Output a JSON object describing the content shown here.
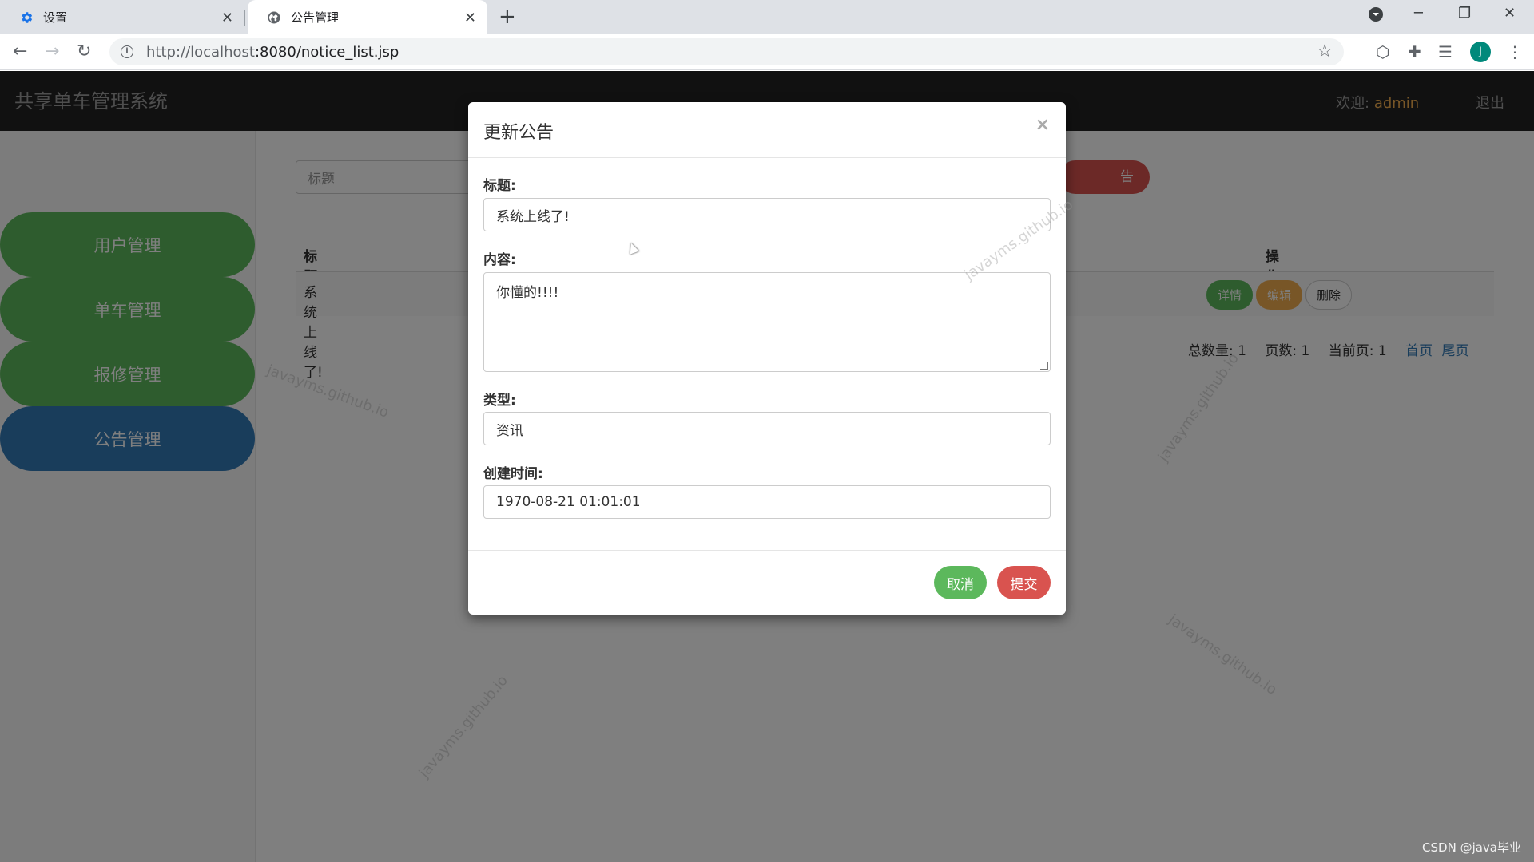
{
  "browser": {
    "tabs": [
      {
        "label": "设置",
        "icon": "gear-icon"
      },
      {
        "label": "公告管理",
        "icon": "globe-icon"
      }
    ],
    "url_host": "http://localhost",
    "url_rest": ":8080/notice_list.jsp",
    "profile_initial": "J"
  },
  "app": {
    "brand": "共享单车管理系统",
    "welcome_label": "欢迎:",
    "username": "admin",
    "logout": "退出"
  },
  "sidebar": {
    "items": [
      {
        "label": "用户管理"
      },
      {
        "label": "单车管理"
      },
      {
        "label": "报修管理"
      },
      {
        "label": "公告管理"
      }
    ]
  },
  "list": {
    "search_placeholder": "标题",
    "add_button": "告",
    "columns": {
      "title": "标题",
      "actions": "操作"
    },
    "rows": [
      {
        "title": "系统上线了!"
      }
    ],
    "actions": {
      "detail": "详情",
      "edit": "编辑",
      "delete": "删除"
    },
    "pager": {
      "total": "总数量: 1",
      "pages": "页数: 1",
      "current": "当前页: 1",
      "first": "首页",
      "last": "尾页"
    }
  },
  "modal": {
    "title": "更新公告",
    "close": "×",
    "fields": {
      "title_label": "标题:",
      "title_value": "系统上线了!",
      "content_label": "内容:",
      "content_value": "你懂的!!!!",
      "type_label": "类型:",
      "type_value": "资讯",
      "created_label": "创建时间:",
      "created_value": "1970-08-21 01:01:01"
    },
    "cancel": "取消",
    "submit": "提交"
  },
  "watermark": "javayms.github.io",
  "footer_credit": "CSDN @java毕业",
  "colors": {
    "green": "#5cb85c",
    "blue": "#337ab7",
    "red": "#d9534f",
    "orange": "#f0ad4e",
    "navbar": "#222222"
  }
}
